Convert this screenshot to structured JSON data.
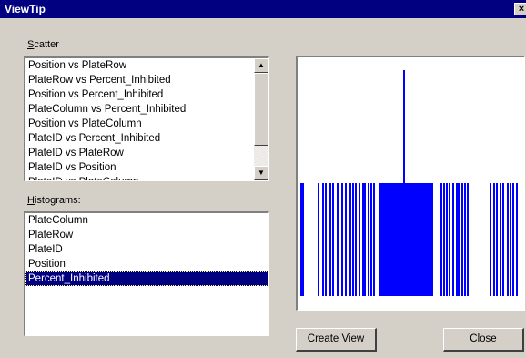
{
  "window": {
    "title": "ViewTip",
    "close_glyph": "×"
  },
  "scatter": {
    "label_accel": "S",
    "label_rest": "catter",
    "items": [
      "Position vs PlateRow",
      "PlateRow vs Percent_Inhibited",
      "Position vs Percent_Inhibited",
      "PlateColumn vs Percent_Inhibited",
      "Position vs PlateColumn",
      "PlateID vs Percent_Inhibited",
      "PlateID vs PlateRow",
      "PlateID vs Position",
      "PlateID vs PlateColumn"
    ]
  },
  "histograms": {
    "label_accel": "H",
    "label_rest": "istograms:",
    "items": [
      "PlateColumn",
      "PlateRow",
      "PlateID",
      "Position",
      "Percent_Inhibited"
    ],
    "selected": "Percent_Inhibited"
  },
  "buttons": {
    "create_pre": "Create ",
    "create_accel": "V",
    "create_post": "iew",
    "close_accel": "C",
    "close_rest": "lose"
  },
  "plot_color": "#0000ff"
}
